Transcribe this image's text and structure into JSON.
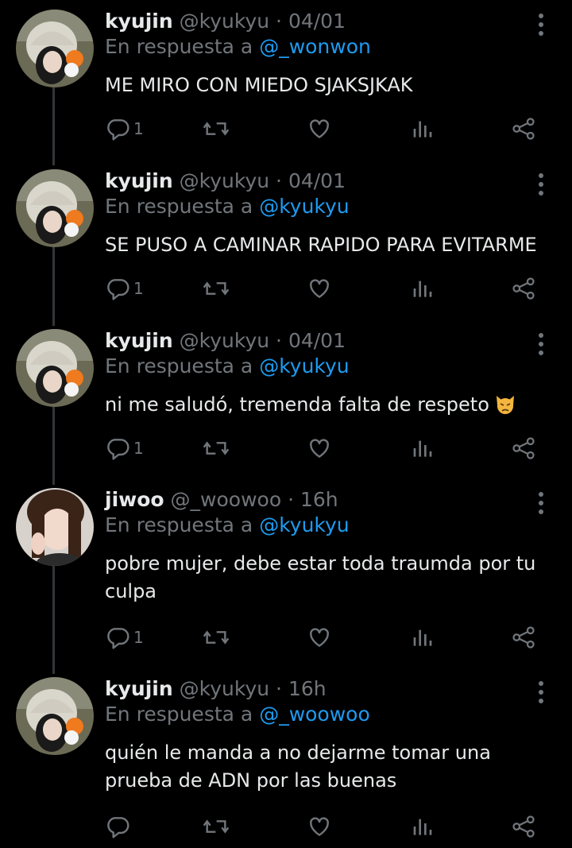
{
  "tweets": [
    {
      "name": "kyujin",
      "handle": "@kyukyu",
      "time": "04/01",
      "reply_prefix": "En respuesta a",
      "reply_to": "@_wonwon",
      "text": "ME MIRO CON MIEDO SJAKSJKAK",
      "reply_count": "1"
    },
    {
      "name": "kyujin",
      "handle": "@kyukyu",
      "time": "04/01",
      "reply_prefix": "En respuesta a",
      "reply_to": "@kyukyu",
      "text": "SE PUSO A CAMINAR RAPIDO PARA EVITARME",
      "reply_count": "1"
    },
    {
      "name": "kyujin",
      "handle": "@kyukyu",
      "time": "04/01",
      "reply_prefix": "En respuesta a",
      "reply_to": "@kyukyu",
      "text": "ni me saludó, tremenda falta de respeto",
      "reply_count": "1"
    },
    {
      "name": "jiwoo",
      "handle": "@_woowoo",
      "time": "16h",
      "reply_prefix": "En respuesta a",
      "reply_to": "@kyukyu",
      "text": "pobre mujer, debe estar toda traumda por tu culpa",
      "reply_count": "1"
    },
    {
      "name": "kyujin",
      "handle": "@kyukyu",
      "time": "16h",
      "reply_prefix": "En respuesta a",
      "reply_to": "@_woowoo",
      "text": "quién le manda a no dejarme tomar una prueba de ADN por las buenas",
      "reply_count": ""
    }
  ],
  "separator": "·",
  "icons": {
    "reply": "reply-icon",
    "retweet": "retweet-icon",
    "like": "heart-icon",
    "views": "views-icon",
    "share": "share-icon",
    "more": "more-vertical-icon",
    "emoji": "pouting-cat-emoji"
  },
  "colors": {
    "background": "#000000",
    "text": "#e7e9ea",
    "muted": "#71767b",
    "link": "#1d9bf0",
    "thread_line": "#333639"
  }
}
